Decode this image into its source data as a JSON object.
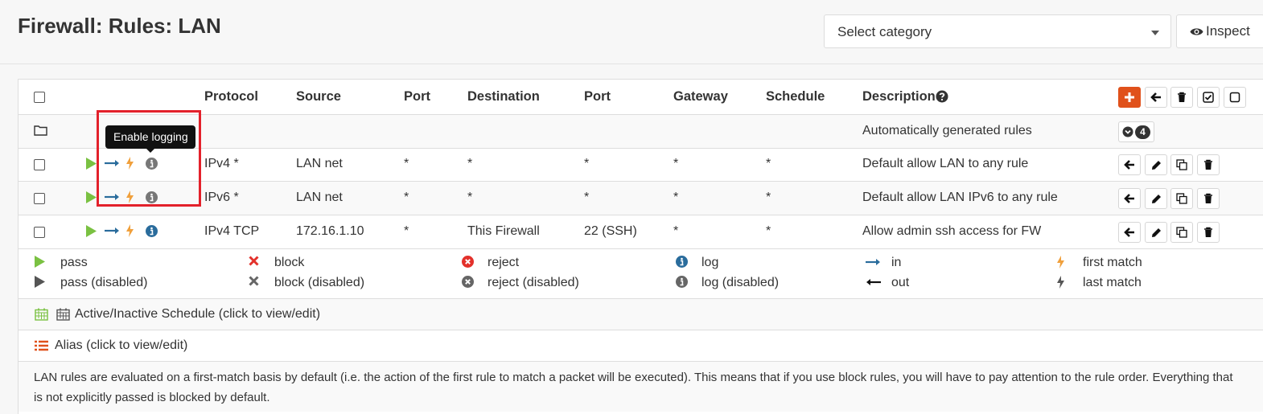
{
  "page": {
    "title": "Firewall: Rules: LAN"
  },
  "header": {
    "category_placeholder": "Select category",
    "inspect_label": "Inspect"
  },
  "table": {
    "columns": [
      "Protocol",
      "Source",
      "Port",
      "Destination",
      "Port",
      "Gateway",
      "Schedule",
      "Description"
    ],
    "auto_group": {
      "label": "Automatically generated rules",
      "count": "4"
    },
    "rows": [
      {
        "protocol": "IPv4 *",
        "source": "LAN net",
        "src_port": "*",
        "destination": "*",
        "dst_port": "*",
        "gateway": "*",
        "schedule": "*",
        "description": "Default allow LAN to any rule",
        "log_enabled": false
      },
      {
        "protocol": "IPv6 *",
        "source": "LAN net",
        "src_port": "*",
        "destination": "*",
        "dst_port": "*",
        "gateway": "*",
        "schedule": "*",
        "description": "Default allow LAN IPv6 to any rule",
        "log_enabled": false
      },
      {
        "protocol": "IPv4 TCP",
        "source": "172.16.1.10",
        "src_port": "*",
        "destination": "This Firewall",
        "dst_port": "22 (SSH)",
        "gateway": "*",
        "schedule": "*",
        "description": "Allow admin ssh access for FW",
        "log_enabled": true
      }
    ]
  },
  "tooltip": {
    "text": "Enable logging"
  },
  "legend": {
    "pass": "pass",
    "pass_disabled": "pass (disabled)",
    "block": "block",
    "block_disabled": "block (disabled)",
    "reject": "reject",
    "reject_disabled": "reject (disabled)",
    "log": "log",
    "log_disabled": "log (disabled)",
    "in": "in",
    "out": "out",
    "first_match": "first match",
    "last_match": "last match"
  },
  "footer": {
    "schedule_label": "Active/Inactive Schedule (click to view/edit)",
    "alias_label": "Alias (click to view/edit)",
    "note": "LAN rules are evaluated on a first-match basis by default (i.e. the action of the first rule to match a packet will be executed). This means that if you use block rules, you will have to pay attention to the rule order. Everything that is not explicitly passed is blocked by default."
  },
  "colors": {
    "pass": "#7ac142",
    "in_arrow": "#2a6c9c",
    "match_bolt": "#f0a03c",
    "block": "#e3312b",
    "add_button": "#e0511b",
    "info_active": "#2a6c9c",
    "info_inactive": "#777777",
    "highlight": "#e3212b"
  }
}
